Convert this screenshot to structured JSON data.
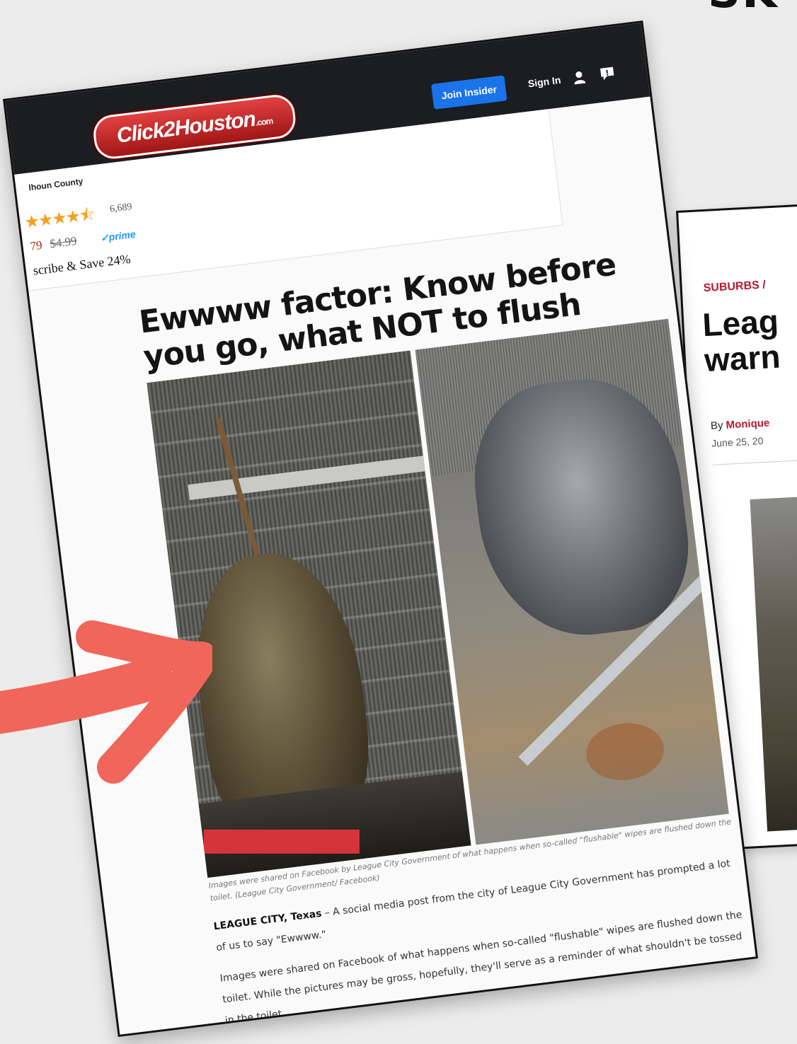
{
  "background": {
    "title_fragment": "SK"
  },
  "secondary_article": {
    "section": "SUBURBS /",
    "headline_line1": "Leag",
    "headline_line2": "warn",
    "byline_prefix": "By ",
    "byline_author": "Monique",
    "date": "June 25, 20"
  },
  "site": {
    "logo_text": "Click2Houston",
    "logo_suffix": ".com",
    "join_button": "Join Insider",
    "sign_in": "Sign In"
  },
  "ad": {
    "county": "lhoun County",
    "stars": "★★★★⯪",
    "rating_count": "6,689",
    "price_old": "79",
    "price": "$4.99",
    "prime": "✓prime",
    "subscribe": "scribe & Save 24%"
  },
  "article": {
    "title": "Ewwww factor: Know before you go, what NOT to flush",
    "caption": "Images were shared on Facebook by League City Government of what happens when so-called \"flushable\" wipes are flushed down the toilet. (League City Government/ Facebook)",
    "dateline": "LEAGUE CITY, Texas",
    "para1": " – A social media post from the city of League City Government has prompted a lot of us to say \"Ewwww.\"",
    "para2": "Images were shared on Facebook of what happens when so-called \"flushable\" wipes are flushed down the toilet. While the pictures may be gross, hopefully, they'll serve as a reminder of what shouldn't be tossed in the toilet."
  },
  "colors": {
    "accent_red": "#b8182e",
    "join_blue": "#1a73e8",
    "arrow": "#f0665a"
  },
  "icons": [
    "user-icon",
    "chat-icon",
    "arrow-annotation"
  ]
}
